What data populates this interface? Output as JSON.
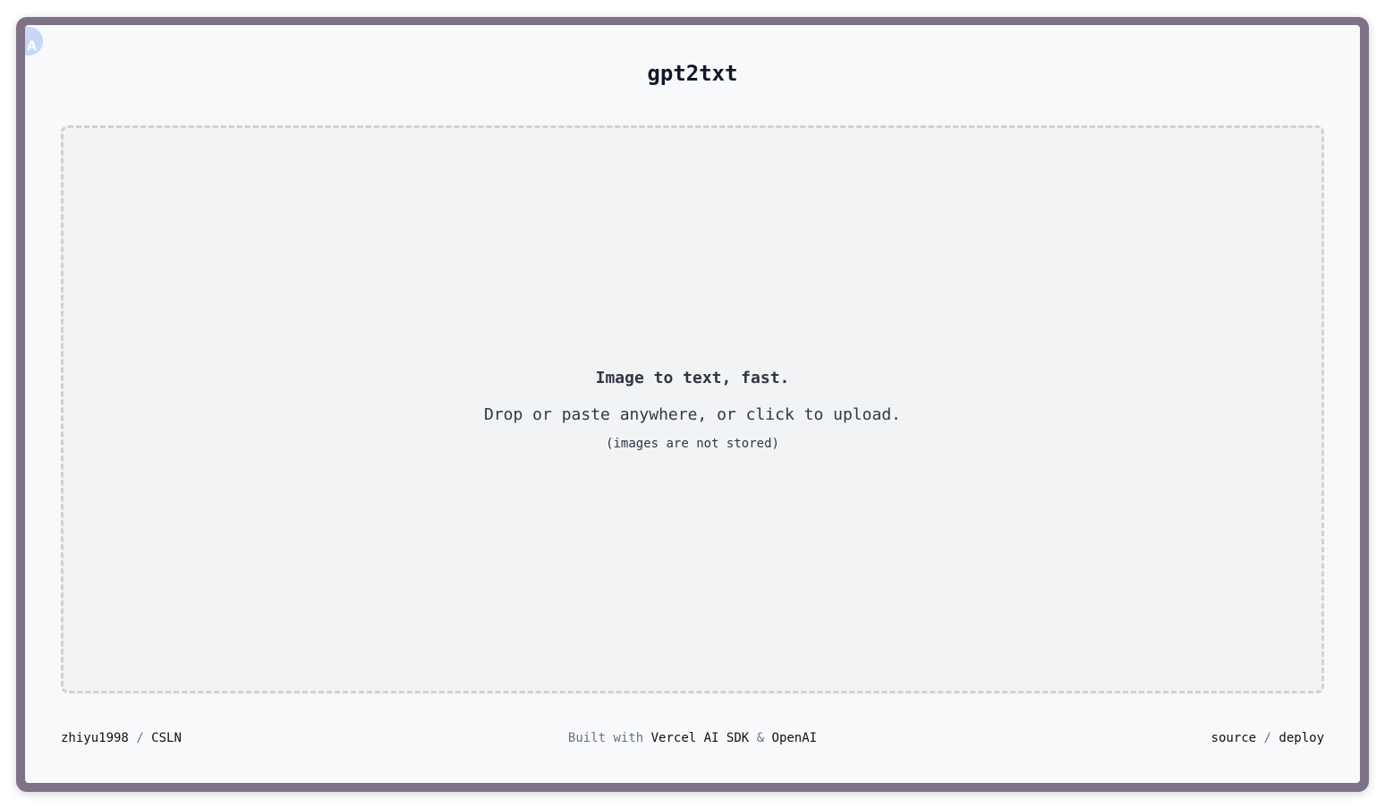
{
  "app": {
    "title": "gpt2txt",
    "avatar_text": "A"
  },
  "dropzone": {
    "heading": "Image to text, fast.",
    "instruction": "Drop or paste anywhere, or click to upload.",
    "note": "(images are not stored)",
    "border_color": "#d1d1d4",
    "background_color": "#f2f3f5"
  },
  "footer": {
    "left": {
      "author_link": "zhiyu1998",
      "separator": "/",
      "org_link": "CSLN"
    },
    "center": {
      "prefix": "Built with",
      "sdk_link": "Vercel AI SDK",
      "ampersand": "&",
      "provider_link": "OpenAI"
    },
    "right": {
      "source_link": "source",
      "separator": "/",
      "deploy_link": "deploy"
    }
  },
  "colors": {
    "window_frame": "#7e7288",
    "page_background": "#f8f9fb",
    "text_primary": "#111827",
    "text_muted": "#6b7280"
  }
}
